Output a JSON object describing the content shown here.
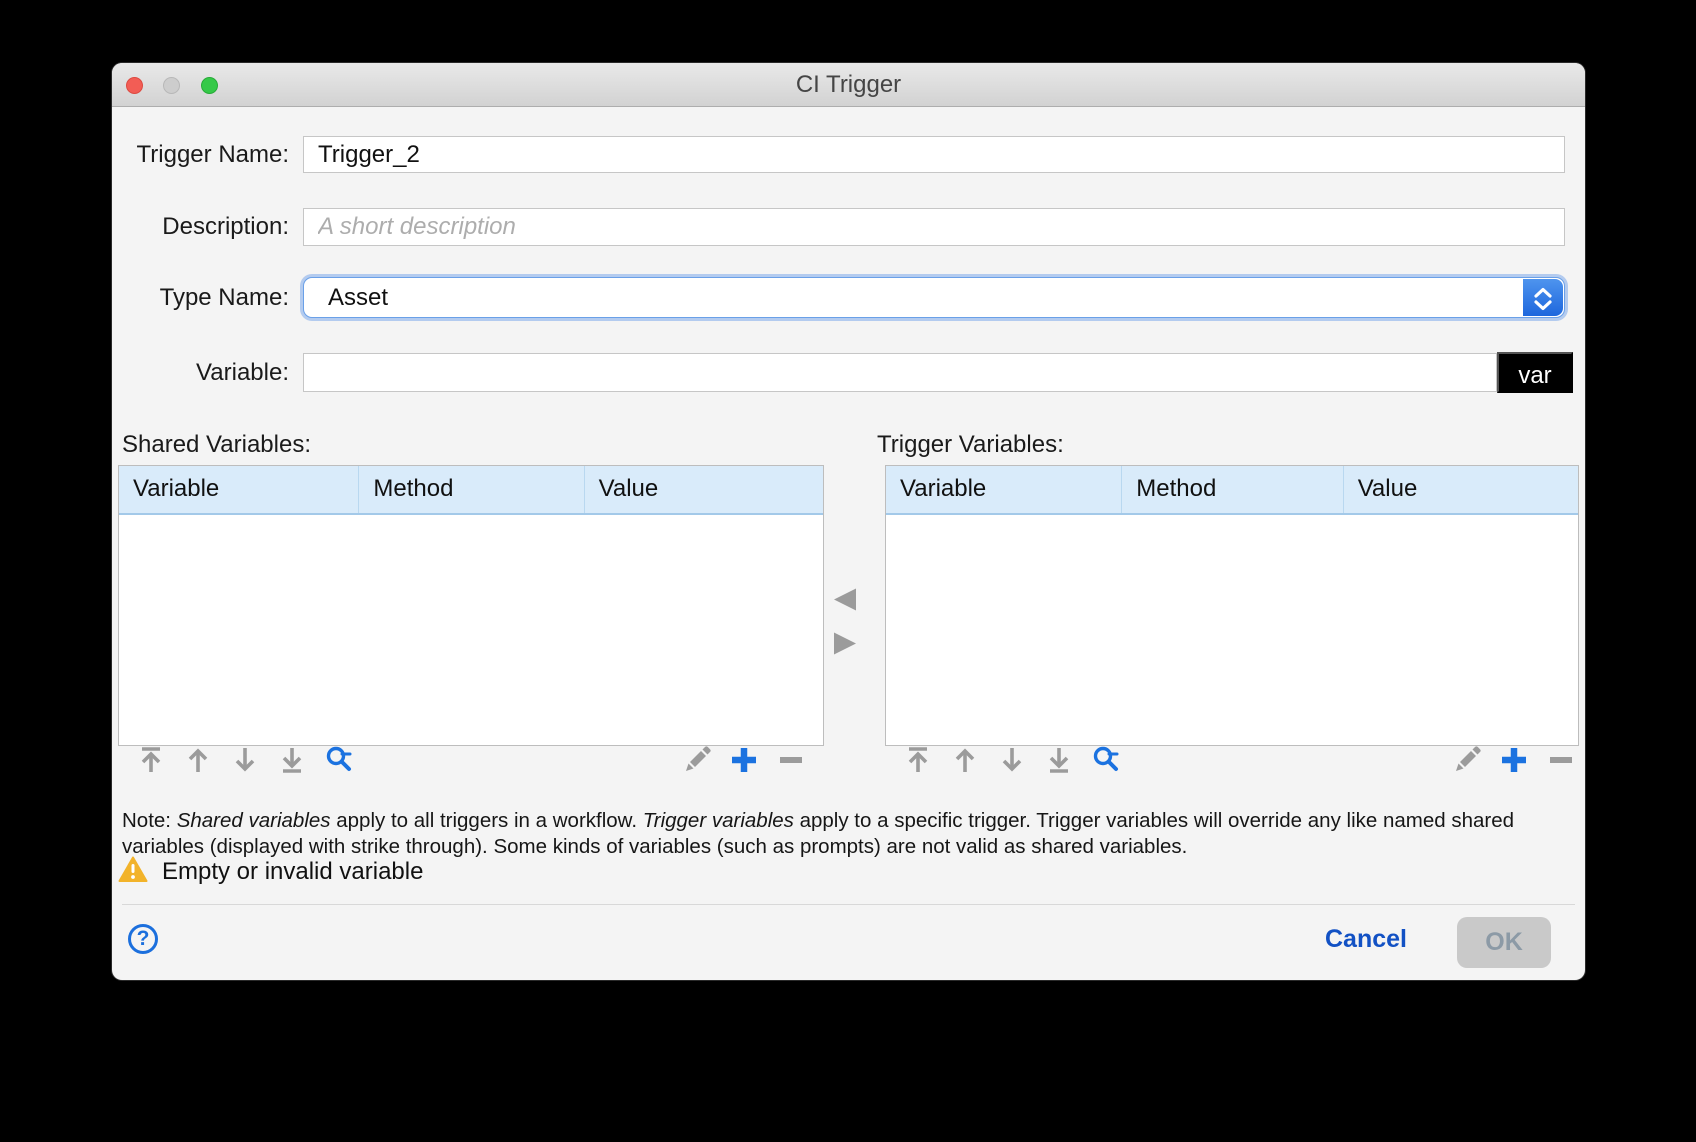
{
  "window": {
    "title": "CI Trigger"
  },
  "form": {
    "trigger_name": {
      "label": "Trigger Name:",
      "value": "Trigger_2"
    },
    "description": {
      "label": "Description:",
      "value": "",
      "placeholder": "A short description"
    },
    "type_name": {
      "label": "Type Name:",
      "selected_value": "Asset"
    },
    "variable": {
      "label": "Variable:",
      "value": "",
      "var_button_label": "var"
    }
  },
  "shared_variables": {
    "label": "Shared Variables:",
    "columns": [
      "Variable",
      "Method",
      "Value"
    ],
    "rows": []
  },
  "trigger_variables": {
    "label": "Trigger Variables:",
    "columns": [
      "Variable",
      "Method",
      "Value"
    ],
    "rows": []
  },
  "note": {
    "prefix": "Note: ",
    "shared_italic": "Shared variables",
    "middle": " apply to all triggers in a workflow. ",
    "trigger_italic": "Trigger variables",
    "rest": " apply to a specific trigger. Trigger variables will override any like named shared variables (displayed with strike through). Some kinds of variables (such as prompts) are not valid as shared variables."
  },
  "warning": {
    "text": "Empty or invalid variable"
  },
  "footer": {
    "help_label": "?",
    "cancel_label": "Cancel",
    "ok_label": "OK"
  },
  "icons": [
    "move-to-top-icon",
    "move-up-icon",
    "move-down-icon",
    "move-to-bottom-icon",
    "search-icon",
    "edit-pencil-icon",
    "add-icon",
    "remove-icon",
    "transfer-left-icon",
    "transfer-right-icon",
    "warning-icon",
    "help-icon",
    "combobox-stepper-icon",
    "close-icon",
    "minimize-icon",
    "zoom-icon"
  ],
  "colors": {
    "accent_blue": "#1b72e0",
    "table_header_bg": "#d9ebfa",
    "warning_yellow": "#f2b32a",
    "traffic_red": "#f25d55",
    "traffic_gray": "#cdcdcd",
    "traffic_green": "#35c948",
    "cancel_blue": "#1251c4",
    "var_button_bg": "#000000"
  }
}
